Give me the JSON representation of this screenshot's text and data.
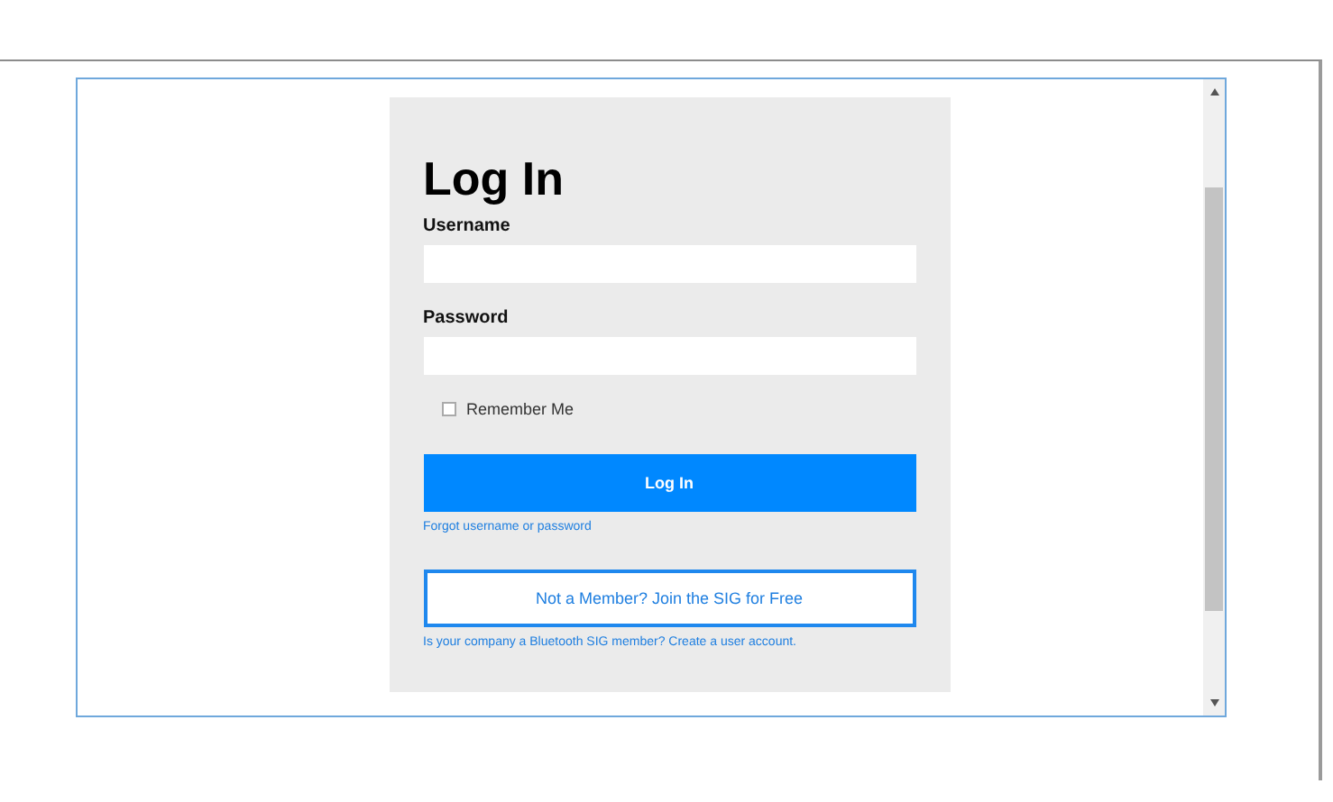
{
  "login": {
    "title": "Log In",
    "fields": [
      {
        "label": "Username"
      },
      {
        "label": "Password"
      }
    ],
    "remember": {
      "label": "Remember Me",
      "checked": false
    },
    "submit": "Log In",
    "forgot_link": "Forgot username or password",
    "join_button": "Not a Member? Join the SIG for Free",
    "company_link": "Is your company a Bluetooth SIG member? Create a user account."
  }
}
